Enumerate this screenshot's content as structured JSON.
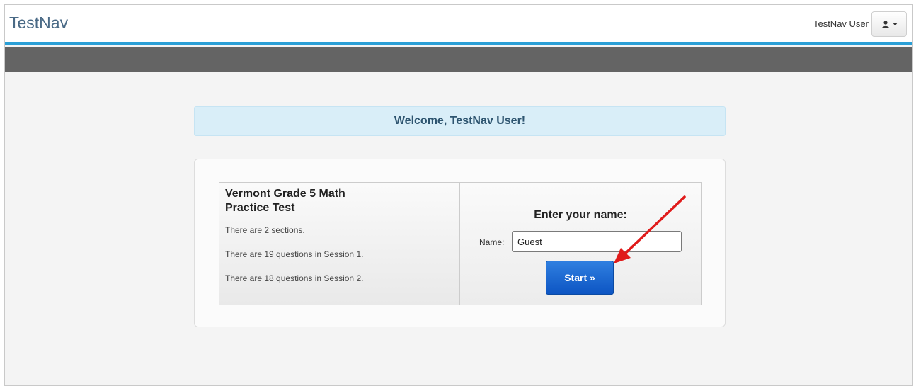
{
  "header": {
    "brand": "TestNav",
    "user_name": "TestNav User",
    "user_menu_icon": "user-icon",
    "user_menu_caret": "caret-down-icon"
  },
  "welcome": {
    "message": "Welcome, TestNav User!"
  },
  "test": {
    "title": "Vermont Grade 5 Math Practice Test",
    "info": [
      "There are 2 sections.",
      "There are 19 questions in Session 1.",
      "There are 18 questions in Session 2."
    ]
  },
  "signin": {
    "heading": "Enter your name:",
    "name_label": "Name:",
    "name_value": "Guest",
    "start_label": "Start »"
  },
  "colors": {
    "accent": "#2a9fd6",
    "welcome_bg": "#d9eef8",
    "start_button": "#1565d1",
    "annotation_arrow": "#e01b1b"
  }
}
